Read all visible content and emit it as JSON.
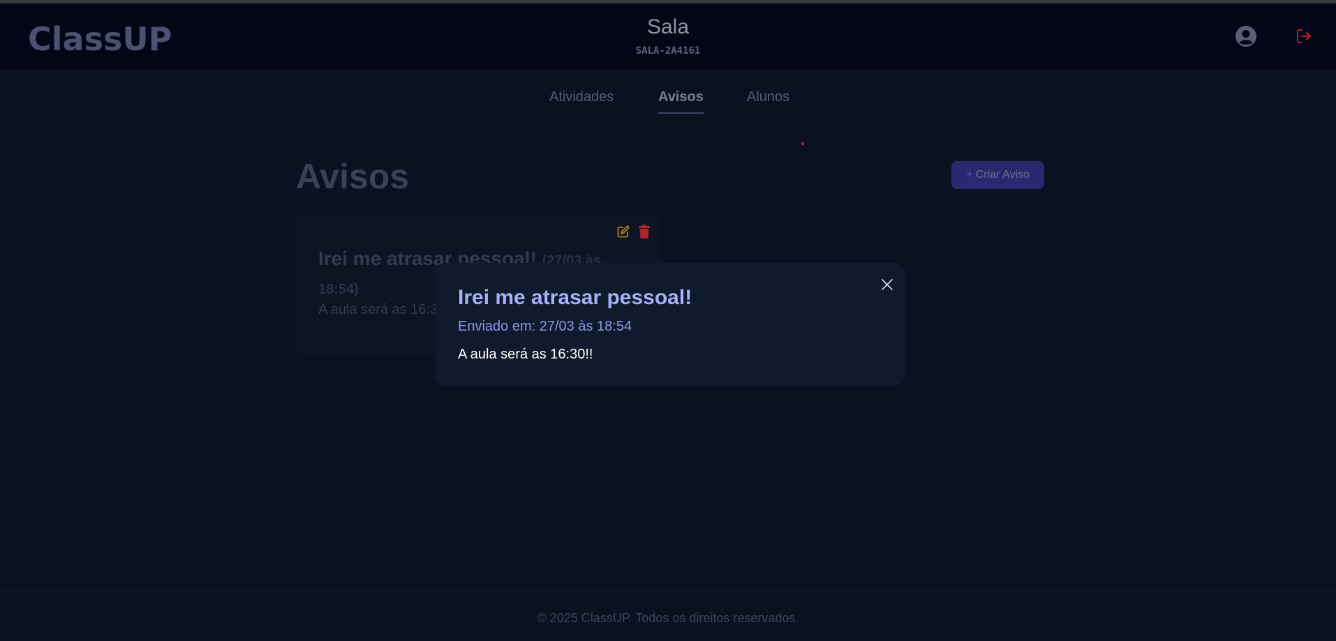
{
  "header": {
    "logo": "ClassUP",
    "room_title": "Sala",
    "room_code": "SALA-2A4161",
    "user_icon": "user-circle-icon",
    "logout_icon": "logout-icon"
  },
  "tabs": [
    {
      "label": "Atividades",
      "active": false
    },
    {
      "label": "Avisos",
      "active": true
    },
    {
      "label": "Alunos",
      "active": false
    }
  ],
  "page": {
    "title": "Avisos",
    "create_button": "+ Criar Aviso"
  },
  "card": {
    "title": "Irei me atrasar pessoal!",
    "date": "(27/03 às 18:54)",
    "body": "A aula será as 16:30!!",
    "edit_icon": "edit-icon",
    "delete_icon": "trash-icon"
  },
  "modal": {
    "title": "Irei me atrasar pessoal!",
    "sent": "Enviado em: 27/03 às 18:54",
    "body": "A aula será as 16:30!!",
    "close_icon": "close-icon"
  },
  "footer": {
    "text": "© 2025 ClassUP. Todos os direitos reservados."
  },
  "colors": {
    "background": "#0b1120",
    "header_bg": "#020617",
    "accent": "#2a2870",
    "modal_title": "#a5b1f8",
    "logout": "#c4202a",
    "edit": "#b8860b",
    "delete": "#c4202a"
  }
}
